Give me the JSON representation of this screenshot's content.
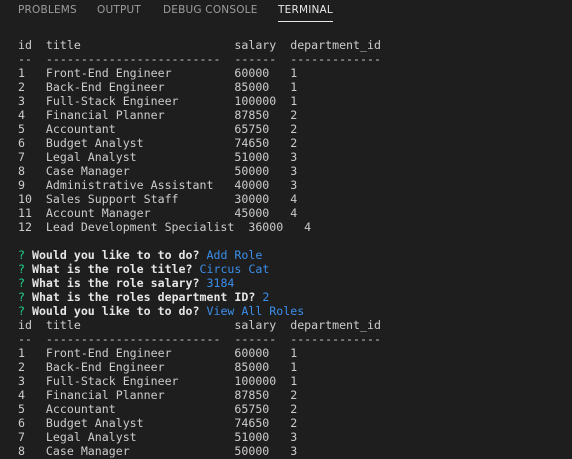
{
  "tabs": [
    {
      "label": "PROBLEMS",
      "active": false
    },
    {
      "label": "OUTPUT",
      "active": false
    },
    {
      "label": "DEBUG CONSOLE",
      "active": false
    },
    {
      "label": "TERMINAL",
      "active": true
    }
  ],
  "colors": {
    "background": "#1e1e1e",
    "text": "#cccccc",
    "prompt_mark": "#23d18b",
    "answer": "#3b8eea"
  },
  "terminal": {
    "lines": [
      {
        "kind": "text",
        "text": "id  title                      salary  department_id"
      },
      {
        "kind": "text",
        "text": "--  -------------------------  ------  -------------"
      },
      {
        "kind": "text",
        "text": "1   Front-End Engineer         60000   1"
      },
      {
        "kind": "text",
        "text": "2   Back-End Engineer          85000   1"
      },
      {
        "kind": "text",
        "text": "3   Full-Stack Engineer        100000  1"
      },
      {
        "kind": "text",
        "text": "4   Financial Planner          87850   2"
      },
      {
        "kind": "text",
        "text": "5   Accountant                 65750   2"
      },
      {
        "kind": "text",
        "text": "6   Budget Analyst             74650   2"
      },
      {
        "kind": "text",
        "text": "7   Legal Analyst              51000   3"
      },
      {
        "kind": "text",
        "text": "8   Case Manager               50000   3"
      },
      {
        "kind": "text",
        "text": "9   Administrative Assistant   40000   3"
      },
      {
        "kind": "text",
        "text": "10  Sales Support Staff        30000   4"
      },
      {
        "kind": "text",
        "text": "11  Account Manager            45000   4"
      },
      {
        "kind": "text",
        "text": "12  Lead Development Specialist  36000   4"
      },
      {
        "kind": "text",
        "text": ""
      },
      {
        "kind": "prompt",
        "mark": "?",
        "question": "Would you like to to do?",
        "answer": "Add Role"
      },
      {
        "kind": "prompt",
        "mark": "?",
        "question": "What is the role title?",
        "answer": "Circus Cat"
      },
      {
        "kind": "prompt",
        "mark": "?",
        "question": "What is the role salary?",
        "answer": "3184"
      },
      {
        "kind": "prompt",
        "mark": "?",
        "question": "What is the roles department ID?",
        "answer": "2"
      },
      {
        "kind": "prompt",
        "mark": "?",
        "question": "Would you like to to do?",
        "answer": "View All Roles"
      },
      {
        "kind": "text",
        "text": "id  title                      salary  department_id"
      },
      {
        "kind": "text",
        "text": "--  -------------------------  ------  -------------"
      },
      {
        "kind": "text",
        "text": "1   Front-End Engineer         60000   1"
      },
      {
        "kind": "text",
        "text": "2   Back-End Engineer          85000   1"
      },
      {
        "kind": "text",
        "text": "3   Full-Stack Engineer        100000  1"
      },
      {
        "kind": "text",
        "text": "4   Financial Planner          87850   2"
      },
      {
        "kind": "text",
        "text": "5   Accountant                 65750   2"
      },
      {
        "kind": "text",
        "text": "6   Budget Analyst             74650   2"
      },
      {
        "kind": "text",
        "text": "7   Legal Analyst              51000   3"
      },
      {
        "kind": "text",
        "text": "8   Case Manager               50000   3"
      }
    ]
  }
}
